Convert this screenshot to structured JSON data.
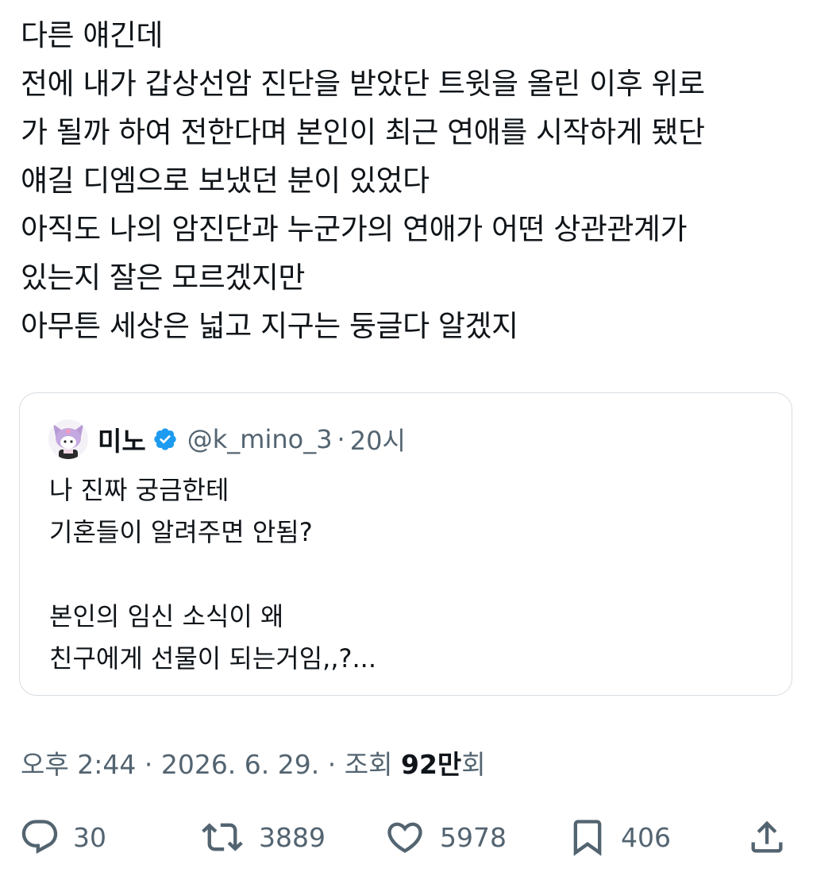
{
  "tweet": {
    "lines": [
      "다른 얘긴데",
      "전에 내가 갑상선암 진단을 받았단 트윗을 올린 이후 위로",
      "가 될까 하여 전한다며 본인이 최근 연애를 시작하게 됐단",
      "얘길 디엠으로 보냈던 분이 있었다",
      "아직도 나의 암진단과 누군가의 연애가 어떤 상관관계가",
      "있는지 잘은 모르겠지만",
      "아무튼 세상은 넓고 지구는 둥글다 알겠지"
    ]
  },
  "quote": {
    "name": "미노",
    "handle": "@k_mino_3",
    "separator": "·",
    "time": "20시",
    "avatar_icon": "kuromi-avatar-icon",
    "verified_icon": "verified-badge-icon",
    "verified_color": "#1d9bf0",
    "lines": [
      "나 진짜 궁금한테",
      "기혼들이 알려주면 안됨?",
      "",
      "본인의 임신 소식이 왜",
      "친구에게 선물이 되는거임,,?..."
    ]
  },
  "meta": {
    "time": "오후 2:44",
    "date": "2026. 6. 29.",
    "separator": "·",
    "views_label": "조회",
    "views_count": "92만",
    "views_suffix": "회"
  },
  "actions": {
    "reply": {
      "icon": "reply-icon",
      "count": "30"
    },
    "retweet": {
      "icon": "retweet-icon",
      "count": "3889"
    },
    "like": {
      "icon": "heart-icon",
      "count": "5978"
    },
    "bookmark": {
      "icon": "bookmark-icon",
      "count": "406"
    },
    "share": {
      "icon": "share-icon"
    }
  },
  "colors": {
    "text": "#0f1419",
    "secondary": "#536471",
    "border": "#d7dde2",
    "verified": "#1d9bf0"
  }
}
